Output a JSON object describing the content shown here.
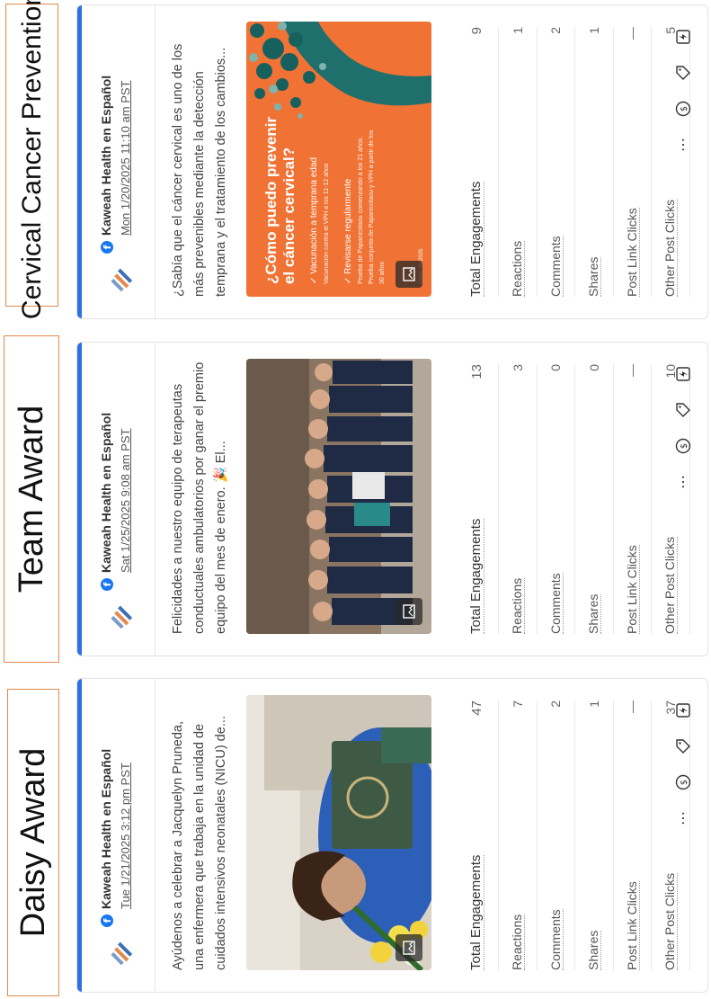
{
  "labels": [
    "Daisy Award",
    "Team Award",
    "Cervical Cancer Prevention"
  ],
  "posts": [
    {
      "page": "Kaweah Health en Español",
      "date": "Tue 1/21/2025 3:12 pm PST",
      "text": "Ayúdenos a celebrar a Jacquelyn Pruneda, una enfermera que trabaja en la unidad de cuidados intensivos neonatales (NICU) de...",
      "metrics": [
        {
          "label": "Total Engagements",
          "value": "47"
        },
        {
          "label": "Reactions",
          "value": "7"
        },
        {
          "label": "Comments",
          "value": "2"
        },
        {
          "label": "Shares",
          "value": "1"
        },
        {
          "label": "Post Link Clicks",
          "value": "—"
        },
        {
          "label": "Other Post Clicks",
          "value": "37"
        }
      ]
    },
    {
      "page": "Kaweah Health en Español",
      "date": "Sat 1/25/2025 9:08 am PST",
      "text": "Felicidades a nuestro equipo de terapeutas conductuales ambulatorios por ganar el premio equipo del mes de enero. 🎉 El...",
      "metrics": [
        {
          "label": "Total Engagements",
          "value": "13"
        },
        {
          "label": "Reactions",
          "value": "3"
        },
        {
          "label": "Comments",
          "value": "0"
        },
        {
          "label": "Shares",
          "value": "0"
        },
        {
          "label": "Post Link Clicks",
          "value": "—"
        },
        {
          "label": "Other Post Clicks",
          "value": "10"
        }
      ]
    },
    {
      "page": "Kaweah Health en Español",
      "date": "Mon 1/20/2025 11:10 am PST",
      "text": "¿Sabía que el cáncer cervical es uno de los más prevenibles mediante la detección temprana y el tratamiento de los cambios...",
      "metrics": [
        {
          "label": "Total Engagements",
          "value": "9"
        },
        {
          "label": "Reactions",
          "value": "1"
        },
        {
          "label": "Comments",
          "value": "2"
        },
        {
          "label": "Shares",
          "value": "1"
        },
        {
          "label": "Post Link Clicks",
          "value": "—"
        },
        {
          "label": "Other Post Clicks",
          "value": "5"
        }
      ],
      "promo": {
        "title": "¿Cómo puedo prevenir el cáncer cervical?",
        "bullet1": "Vacunación a temprana edad",
        "bullet1_sub": "Vacunación contra el VPH a los 11-12 años",
        "bullet2": "Revisarse regularmente",
        "bullet2_sub": "Prueba de Papanicolaou comenzando a los 21 años. Prueba conjunta de Papanicolaou y VPH a partir de los 30 años",
        "footer": "Enero de 2025"
      }
    }
  ],
  "colors": {
    "accent": "#2f6fe4",
    "promo_orange": "#f07234",
    "label_border": "#e0894a",
    "facebook": "#1877f2"
  },
  "icons": [
    "kaweah-logo-icon",
    "facebook-icon",
    "image-icon",
    "more-icon",
    "dollar-icon",
    "tag-icon",
    "boost-icon"
  ]
}
